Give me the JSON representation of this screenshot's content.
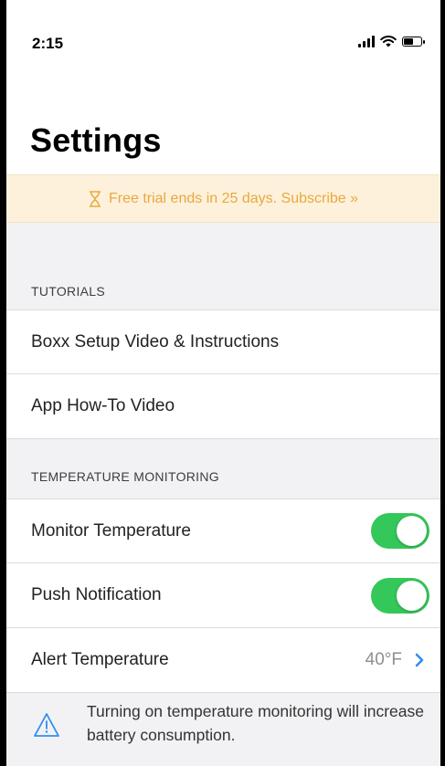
{
  "status_bar": {
    "time": "2:15"
  },
  "page_title": "Settings",
  "trial_banner": {
    "text": "Free trial ends in 25 days. Subscribe »"
  },
  "sections": {
    "tutorials": {
      "header": "TUTORIALS",
      "items": [
        {
          "label": "Boxx Setup Video & Instructions"
        },
        {
          "label": "App How-To Video"
        }
      ]
    },
    "temperature": {
      "header": "TEMPERATURE MONITORING",
      "monitor_label": "Monitor Temperature",
      "monitor_on": true,
      "push_label": "Push Notification",
      "push_on": true,
      "alert_label": "Alert Temperature",
      "alert_value": "40°F"
    }
  },
  "warning": {
    "text": "Turning on temperature monitoring will increase battery consumption."
  },
  "colors": {
    "accent": "#2f8ef0",
    "toggle_on": "#34c759",
    "banner_text": "#e9a93d",
    "banner_bg": "#fdf1dc"
  }
}
